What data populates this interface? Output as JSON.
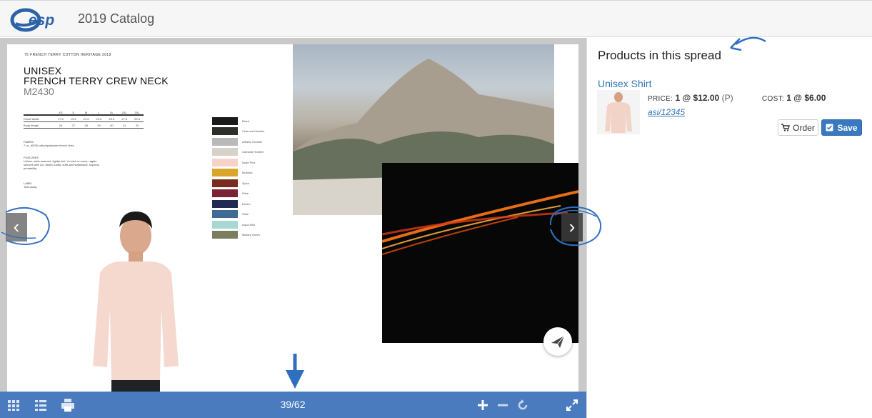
{
  "header": {
    "logo": "esp",
    "catalog_title": "2019 Catalog"
  },
  "catalog_page": {
    "header_small": "75   FRENCH TERRY   COTTON HERITAGE 2019",
    "title_line1": "UNISEX",
    "title_line2": "FRENCH TERRY CREW NECK",
    "code": "M2430",
    "size_table": {
      "headers": [
        "",
        "XS",
        "S",
        "M",
        "L",
        "XL",
        "2XL",
        "3XL"
      ],
      "rows": [
        [
          "Chest Width",
          "17.5",
          "19.5",
          "21.5",
          "23.5",
          "25.5",
          "27.5",
          "29.5"
        ],
        [
          "Body length",
          "26",
          "27",
          "28",
          "29",
          "30",
          "31",
          "32"
        ]
      ]
    },
    "fabric_label": "FABRIC",
    "fabric_text": "7 oz, 65/35 cotton/polyester french terry",
    "features_label": "FEATURES",
    "features_text": "Unisex, wide-seamed, tightly knit. V-notch on neck, raglan sleeves with 2x1 ribbed collar, cuffs and waistband, superior printability.",
    "label_label": "LABEL",
    "label_text": "Tear-away.",
    "colors": [
      {
        "name": "Black",
        "hex": "#1b1b1b"
      },
      {
        "name": "Charcoal Heather",
        "hex": "#2e2e2b"
      },
      {
        "name": "Athletic Heather",
        "hex": "#b9b9b9"
      },
      {
        "name": "Oatmeal Heather",
        "hex": "#d6d1c9"
      },
      {
        "name": "Nude Pink",
        "hex": "#f5d3c8"
      },
      {
        "name": "Mustard",
        "hex": "#d9a52a"
      },
      {
        "name": "Spice",
        "hex": "#7a2b1f"
      },
      {
        "name": "Wine",
        "hex": "#7b2235"
      },
      {
        "name": "Denim",
        "hex": "#1f2b52"
      },
      {
        "name": "Slate",
        "hex": "#3f6a95"
      },
      {
        "name": "Aqua Mist",
        "hex": "#a6d8d4"
      },
      {
        "name": "Military Green",
        "hex": "#7a7d5f"
      }
    ]
  },
  "viewer": {
    "prev_icon": "chevron-left-icon",
    "next_icon": "chevron-right-icon",
    "send_icon": "paper-plane-icon",
    "page_counter": "39/62",
    "current_page": 39,
    "total_pages": 62
  },
  "toolbar": {
    "left_icons": [
      "grid-icon",
      "list-icon",
      "print-icon"
    ],
    "right_icons": [
      "zoom-in-icon",
      "zoom-out-icon",
      "reset-icon",
      "fullscreen-icon"
    ]
  },
  "panel": {
    "title": "Products in this spread",
    "product": {
      "name": "Unisex Shirt",
      "price_label": "PRICE:",
      "price_value": "1 @ $12.00",
      "price_suffix": "(P)",
      "cost_label": "COST:",
      "cost_value": "1 @ $6.00",
      "asi": "asi/12345",
      "order_label": "Order",
      "save_label": "Save"
    }
  },
  "colors": {
    "accent": "#4a7bbf",
    "link": "#3275b8",
    "save_button": "#3a78bf",
    "annotation": "#2f6fc0"
  }
}
